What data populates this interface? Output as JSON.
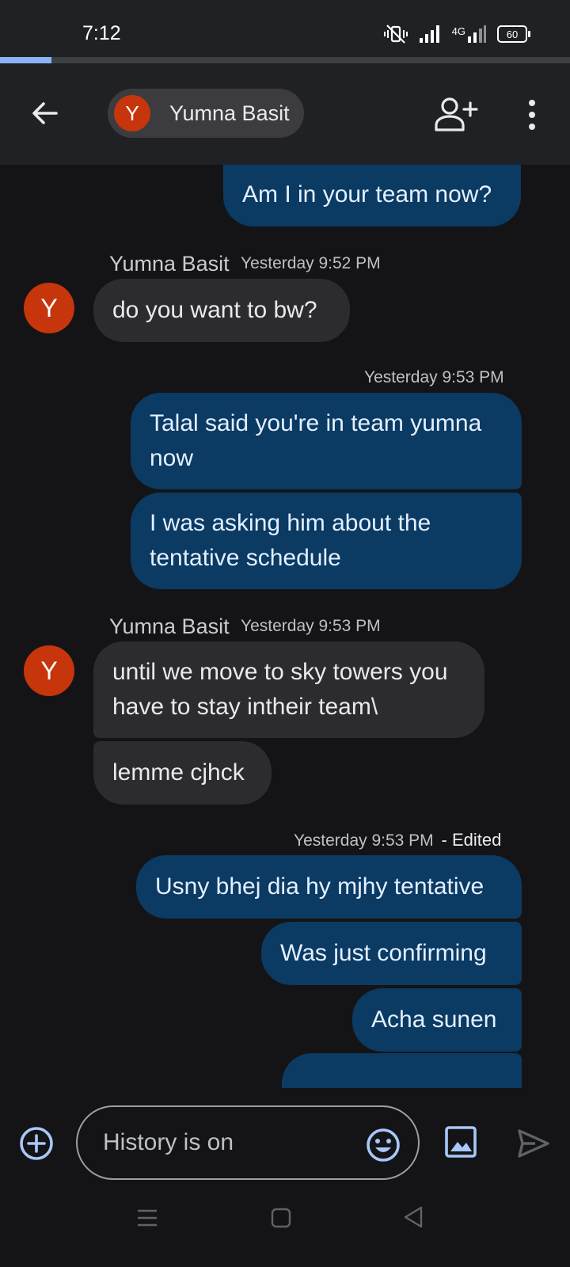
{
  "status_bar": {
    "time": "7:12",
    "network": "4G",
    "battery": "60",
    "icons": [
      "vibrate-off-icon",
      "signal-icon",
      "signal-4g-icon",
      "battery-icon"
    ]
  },
  "progress": {
    "fraction": 0.09
  },
  "app_bar": {
    "contact_name": "Yumna Basit",
    "contact_initial": "Y",
    "icons": [
      "back-arrow-icon",
      "add-person-icon",
      "more-vert-icon"
    ]
  },
  "messages": [
    {
      "id": "m1",
      "direction": "outgoing",
      "text": "Am I in your team now?"
    },
    {
      "id": "g1",
      "type": "incoming_header",
      "sender": "Yumna Basit",
      "timestamp": "Yesterday 9:52 PM",
      "initial": "Y"
    },
    {
      "id": "m2",
      "direction": "incoming",
      "text": "do you want to bw?"
    },
    {
      "id": "g2",
      "type": "outgoing_header",
      "timestamp": "Yesterday 9:53 PM"
    },
    {
      "id": "m3",
      "direction": "outgoing",
      "text": "Talal said you're in team yumna now"
    },
    {
      "id": "m4",
      "direction": "outgoing",
      "text": "I was asking him about the tentative schedule"
    },
    {
      "id": "g3",
      "type": "incoming_header",
      "sender": "Yumna Basit",
      "timestamp": "Yesterday 9:53 PM",
      "initial": "Y"
    },
    {
      "id": "m5",
      "direction": "incoming",
      "text": "until we move to sky towers you have to stay intheir team\\"
    },
    {
      "id": "m6",
      "direction": "incoming",
      "text": "lemme cjhck"
    },
    {
      "id": "g4",
      "type": "outgoing_header",
      "timestamp": "Yesterday 9:53 PM",
      "edited": "- Edited"
    },
    {
      "id": "m7",
      "direction": "outgoing",
      "text": "Usny bhej dia hy mjhy tentative"
    },
    {
      "id": "m8",
      "direction": "outgoing",
      "text": "Was just confirming"
    },
    {
      "id": "m9",
      "direction": "outgoing",
      "text": "Acha sunen"
    }
  ],
  "composer": {
    "placeholder": "History is on",
    "icons": [
      "add-circle-icon",
      "emoji-icon",
      "image-icon",
      "send-icon"
    ]
  },
  "nav_bar": {
    "icons": [
      "recents-icon",
      "home-icon",
      "back-triangle-icon"
    ]
  },
  "colors": {
    "outgoing_bubble": "#0b3a63",
    "incoming_bubble": "#2c2c2e",
    "avatar": "#c6350b",
    "accent": "#8ab4f8",
    "background": "#141416"
  }
}
